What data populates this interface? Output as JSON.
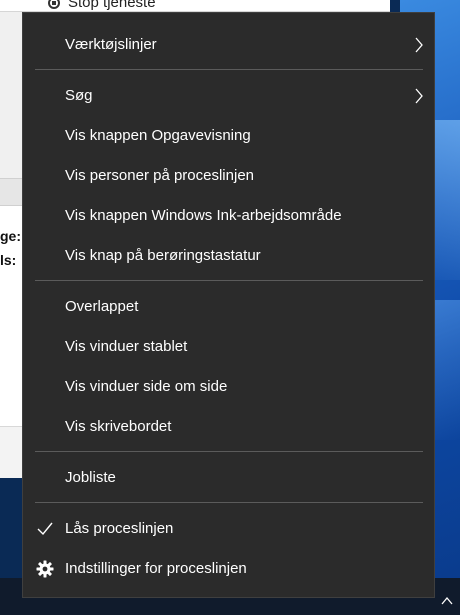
{
  "background_window": {
    "stop_service_label": "Stop tjeneste",
    "label_1": "ge:",
    "label_2": "ls:"
  },
  "menu": {
    "items": [
      {
        "label": "Værktøjslinjer",
        "has_submenu": true
      },
      {
        "label": "Søg",
        "has_submenu": true
      },
      {
        "label": "Vis knappen Opgavevisning"
      },
      {
        "label": "Vis personer på proceslinjen"
      },
      {
        "label": "Vis knappen Windows Ink-arbejdsområde"
      },
      {
        "label": "Vis knap på berøringstastatur"
      },
      {
        "label": "Overlappet"
      },
      {
        "label": "Vis vinduer stablet"
      },
      {
        "label": "Vis vinduer side om side"
      },
      {
        "label": "Vis skrivebordet"
      },
      {
        "label": "Jobliste"
      },
      {
        "label": "Lås proceslinjen",
        "checked": true,
        "icon": "checkmark-icon"
      },
      {
        "label": "Indstillinger for proceslinjen",
        "icon": "gear-icon"
      }
    ]
  },
  "colors": {
    "menu_bg": "#2b2b2b",
    "menu_text": "#ffffff",
    "separator": "#5b5b5b",
    "taskbar": "#101b2c"
  }
}
